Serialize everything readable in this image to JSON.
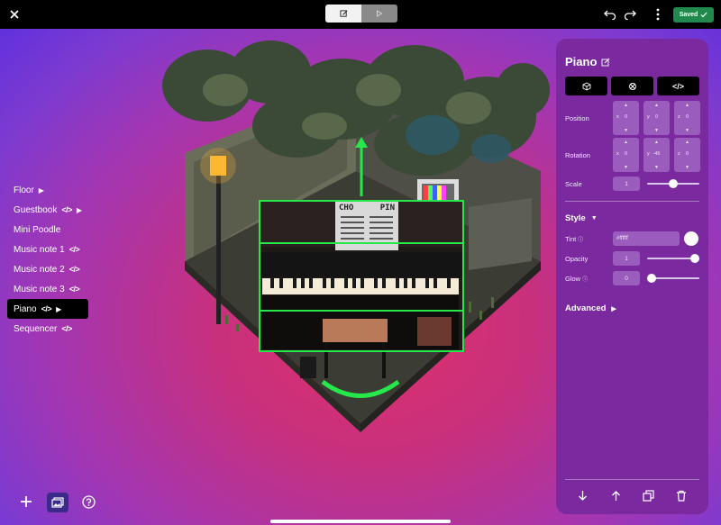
{
  "topbar": {
    "close_icon": "close-icon",
    "mode_edit_icon": "edit-icon",
    "mode_play_icon": "play-icon",
    "undo_icon": "undo-icon",
    "redo_icon": "redo-icon",
    "more_icon": "more-vertical-icon",
    "saved_label": "Saved"
  },
  "sidebar": {
    "items": [
      {
        "label": "Floor",
        "code": "",
        "arrow": "▶"
      },
      {
        "label": "Guestbook",
        "code": "</>",
        "arrow": "▶"
      },
      {
        "label": "Mini Poodle",
        "code": "",
        "arrow": ""
      },
      {
        "label": "Music note 1",
        "code": "</>",
        "arrow": ""
      },
      {
        "label": "Music note 2",
        "code": "</>",
        "arrow": ""
      },
      {
        "label": "Music note 3",
        "code": "</>",
        "arrow": ""
      },
      {
        "label": "Piano",
        "code": "</>",
        "arrow": "▶",
        "active": true
      },
      {
        "label": "Sequencer",
        "code": "</>",
        "arrow": ""
      }
    ]
  },
  "bottom_toolbar": {
    "add_icon": "plus-icon",
    "gallery_icon": "gallery-icon",
    "help_icon": "help-icon"
  },
  "scene": {
    "sign_text_1": "CHO",
    "sign_text_2": "PIN"
  },
  "panel": {
    "title": "Piano",
    "tabs": [
      "cube-icon",
      "target-icon",
      "</>"
    ],
    "position": {
      "label": "Position",
      "x": "0",
      "y": "0",
      "z": "0"
    },
    "rotation": {
      "label": "Rotation",
      "x": "0",
      "y": "-45",
      "z": "0"
    },
    "scale": {
      "label": "Scale",
      "value": "1",
      "level": 0.5
    },
    "style_title": "Style",
    "tint": {
      "label": "Tint",
      "value": "#ffffff"
    },
    "opacity": {
      "label": "Opacity",
      "value": "1",
      "level": 1.0
    },
    "glow": {
      "label": "Glow",
      "value": "0",
      "level": 0.0
    },
    "advanced_title": "Advanced",
    "bottom_icons": [
      "arrow-down-icon",
      "arrow-up-icon",
      "duplicate-icon",
      "trash-icon"
    ]
  },
  "colors": {
    "panel_bg": "#7a2a9e",
    "saved_green": "#1f8a4c",
    "selection_green": "#27e84a"
  }
}
